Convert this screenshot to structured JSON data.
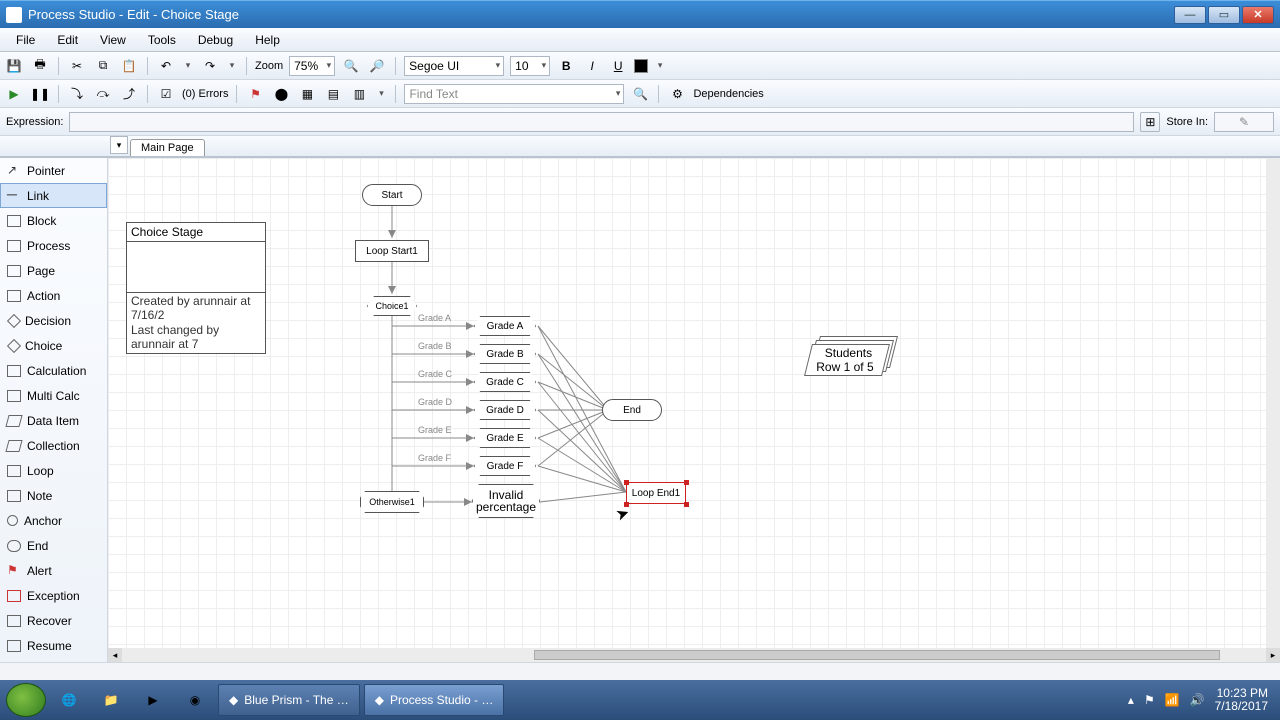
{
  "window": {
    "title": "Process Studio  - Edit - Choice Stage"
  },
  "menu": {
    "file": "File",
    "edit": "Edit",
    "view": "View",
    "tools": "Tools",
    "debug": "Debug",
    "help": "Help"
  },
  "tb": {
    "zoom_label": "Zoom",
    "zoom_value": "75%",
    "font": "Segoe UI",
    "size": "10",
    "errors": "(0) Errors",
    "find_ph": "Find Text",
    "deps": "Dependencies"
  },
  "expr": {
    "label": "Expression:",
    "store": "Store In:"
  },
  "tabs": {
    "main": "Main Page"
  },
  "tools": {
    "pointer": "Pointer",
    "link": "Link",
    "block": "Block",
    "process": "Process",
    "page": "Page",
    "action": "Action",
    "decision": "Decision",
    "choice": "Choice",
    "calculation": "Calculation",
    "multicalc": "Multi Calc",
    "dataitem": "Data Item",
    "collection": "Collection",
    "loop": "Loop",
    "note": "Note",
    "anchor": "Anchor",
    "end": "End",
    "alert": "Alert",
    "exception": "Exception",
    "recover": "Recover",
    "resume": "Resume"
  },
  "info": {
    "title": "Choice Stage",
    "created": "Created by arunnair at 7/16/2",
    "changed": "Last changed by arunnair at 7"
  },
  "nodes": {
    "start": "Start",
    "loopstart": "Loop Start1",
    "choice": "Choice1",
    "gradeA_lbl": "Grade A",
    "gradeA": "Grade A",
    "gradeB_lbl": "Grade B",
    "gradeB": "Grade B",
    "gradeC_lbl": "Grade C",
    "gradeC": "Grade C",
    "gradeD_lbl": "Grade D",
    "gradeD": "Grade D",
    "gradeE_lbl": "Grade E",
    "gradeE": "Grade E",
    "gradeF_lbl": "Grade F",
    "gradeF": "Grade F",
    "otherwise": "Otherwise1",
    "invalid": "Invalid percentage",
    "end": "End",
    "loopend": "Loop End1",
    "students_t": "Students",
    "students_r": "Row 1 of 5"
  },
  "taskbar": {
    "t1": "Blue Prism - The …",
    "t2": "Process Studio - …",
    "time": "10:23 PM",
    "date": "7/18/2017"
  }
}
